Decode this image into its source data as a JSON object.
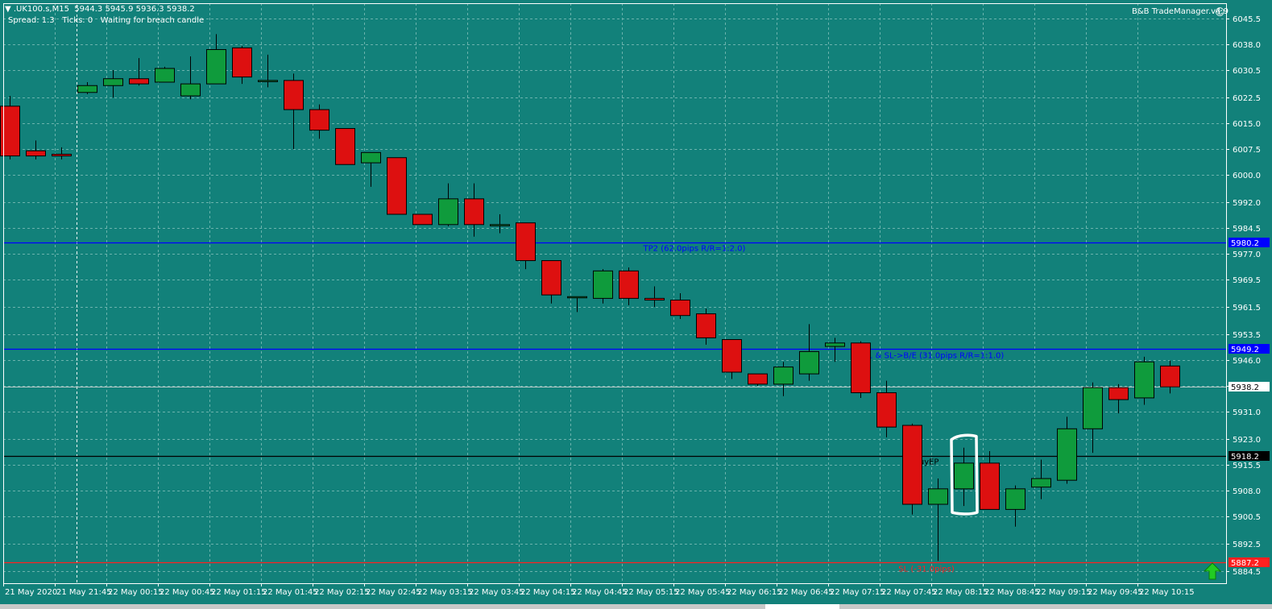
{
  "header": {
    "symbol_line": "▼ .UK100.s,M15  5944.3 5945.9 5936.3 5938.2",
    "status_line": "Spread: 1.3   Ticks: 0   Waiting for breach candle",
    "indicator_name": "B&B TradeManager.v4.9"
  },
  "colors": {
    "background": "#12817a",
    "grid": "#6bb3ad",
    "bull": "#0f9b3c",
    "bear": "#dd1010",
    "tp_line": "#0000ff",
    "entry_line": "#000000",
    "sl_line": "#ff2020",
    "axis_bg": "#ffffff"
  },
  "chart_data": {
    "type": "candlestick",
    "symbol": ".UK100.s",
    "timeframe": "M15",
    "ylim": [
      5881.0,
      6050.0
    ],
    "y_ticks": [
      "6045.5",
      "6038.0",
      "6030.5",
      "6022.5",
      "6015.0",
      "6007.5",
      "6000.0",
      "5992.0",
      "5984.5",
      "5977.0",
      "5969.5",
      "5961.5",
      "5953.5",
      "5946.0",
      "5938.5",
      "5931.0",
      "5923.0",
      "5915.5",
      "5908.0",
      "5900.5",
      "5892.5",
      "5884.5"
    ],
    "x_labels": [
      "21 May 2020",
      "21 May 21:45",
      "22 May 00:15",
      "22 May 00:45",
      "22 May 01:15",
      "22 May 01:45",
      "22 May 02:15",
      "22 May 02:45",
      "22 May 03:15",
      "22 May 03:45",
      "22 May 04:15",
      "22 May 04:45",
      "22 May 05:15",
      "22 May 05:45",
      "22 May 06:15",
      "22 May 06:45",
      "22 May 07:15",
      "22 May 07:45",
      "22 May 08:15",
      "22 May 08:45",
      "22 May 09:15",
      "22 May 09:45",
      "22 May 10:15"
    ],
    "candles": [
      {
        "o": 6020.0,
        "h": 6023.0,
        "l": 6004.5,
        "c": 6005.5
      },
      {
        "o": 6007.0,
        "h": 6010.0,
        "l": 6004.5,
        "c": 6005.5
      },
      {
        "o": 6006.0,
        "h": 6008.0,
        "l": 6004.5,
        "c": 6005.5
      },
      {
        "o": 6024.0,
        "h": 6027.0,
        "l": 6023.5,
        "c": 6026.0
      },
      {
        "o": 6026.0,
        "h": 6030.5,
        "l": 6022.5,
        "c": 6028.0
      },
      {
        "o": 6028.0,
        "h": 6034.0,
        "l": 6026.0,
        "c": 6026.5
      },
      {
        "o": 6027.0,
        "h": 6031.5,
        "l": 6027.0,
        "c": 6031.0
      },
      {
        "o": 6023.0,
        "h": 6034.5,
        "l": 6022.0,
        "c": 6026.5
      },
      {
        "o": 6026.5,
        "h": 6041.0,
        "l": 6026.5,
        "c": 6036.5
      },
      {
        "o": 6037.0,
        "h": 6037.5,
        "l": 6026.5,
        "c": 6028.5
      },
      {
        "o": 6027.5,
        "h": 6035.0,
        "l": 6025.5,
        "c": 6027.5
      },
      {
        "o": 6027.5,
        "h": 6029.5,
        "l": 6007.5,
        "c": 6019.0
      },
      {
        "o": 6019.0,
        "h": 6020.5,
        "l": 6010.5,
        "c": 6013.0
      },
      {
        "o": 6013.5,
        "h": 6013.5,
        "l": 6003.0,
        "c": 6003.0
      },
      {
        "o": 6003.5,
        "h": 6006.5,
        "l": 5996.5,
        "c": 6006.5
      },
      {
        "o": 6005.0,
        "h": 6005.0,
        "l": 5988.5,
        "c": 5988.5
      },
      {
        "o": 5988.5,
        "h": 5988.5,
        "l": 5985.5,
        "c": 5985.5
      },
      {
        "o": 5985.5,
        "h": 5997.5,
        "l": 5985.0,
        "c": 5993.0
      },
      {
        "o": 5993.0,
        "h": 5997.5,
        "l": 5982.0,
        "c": 5985.5
      },
      {
        "o": 5985.5,
        "h": 5988.5,
        "l": 5983.0,
        "c": 5985.5
      },
      {
        "o": 5986.0,
        "h": 5986.0,
        "l": 5972.5,
        "c": 5975.0
      },
      {
        "o": 5975.0,
        "h": 5975.0,
        "l": 5962.5,
        "c": 5965.0
      },
      {
        "o": 5964.5,
        "h": 5964.5,
        "l": 5960.0,
        "c": 5964.5
      },
      {
        "o": 5964.0,
        "h": 5972.5,
        "l": 5962.5,
        "c": 5972.0
      },
      {
        "o": 5972.0,
        "h": 5973.0,
        "l": 5962.0,
        "c": 5964.0
      },
      {
        "o": 5964.0,
        "h": 5967.5,
        "l": 5961.5,
        "c": 5963.5
      },
      {
        "o": 5963.5,
        "h": 5965.5,
        "l": 5958.0,
        "c": 5959.0
      },
      {
        "o": 5959.5,
        "h": 5961.0,
        "l": 5950.5,
        "c": 5952.5
      },
      {
        "o": 5952.0,
        "h": 5952.0,
        "l": 5940.5,
        "c": 5942.5
      },
      {
        "o": 5942.0,
        "h": 5942.0,
        "l": 5938.5,
        "c": 5939.0
      },
      {
        "o": 5939.0,
        "h": 5945.5,
        "l": 5935.5,
        "c": 5944.0
      },
      {
        "o": 5942.0,
        "h": 5956.5,
        "l": 5940.0,
        "c": 5948.5
      },
      {
        "o": 5950.0,
        "h": 5952.5,
        "l": 5945.5,
        "c": 5951.0
      },
      {
        "o": 5951.0,
        "h": 5951.5,
        "l": 5935.0,
        "c": 5936.5
      },
      {
        "o": 5936.5,
        "h": 5940.0,
        "l": 5923.5,
        "c": 5926.5
      },
      {
        "o": 5927.0,
        "h": 5927.5,
        "l": 5901.0,
        "c": 5904.0
      },
      {
        "o": 5904.0,
        "h": 5911.5,
        "l": 5887.5,
        "c": 5908.5
      },
      {
        "o": 5908.5,
        "h": 5920.5,
        "l": 5903.5,
        "c": 5916.0
      },
      {
        "o": 5916.0,
        "h": 5919.5,
        "l": 5902.5,
        "c": 5902.5
      },
      {
        "o": 5902.5,
        "h": 5909.5,
        "l": 5897.5,
        "c": 5908.5
      },
      {
        "o": 5909.0,
        "h": 5917.0,
        "l": 5905.5,
        "c": 5911.5
      },
      {
        "o": 5911.0,
        "h": 5929.5,
        "l": 5910.0,
        "c": 5926.0
      },
      {
        "o": 5926.0,
        "h": 5939.5,
        "l": 5919.0,
        "c": 5938.0
      },
      {
        "o": 5938.0,
        "h": 5939.0,
        "l": 5930.5,
        "c": 5934.5
      },
      {
        "o": 5935.0,
        "h": 5947.0,
        "l": 5933.0,
        "c": 5945.5
      },
      {
        "o": 5944.3,
        "h": 5945.9,
        "l": 5936.3,
        "c": 5938.2
      }
    ],
    "levels": [
      {
        "name": "TP2",
        "price": 5980.2,
        "axis_label": "5980.2",
        "text": "TP2 (62.0pips R/R=1:2.0)",
        "color": "#0000ff"
      },
      {
        "name": "TP1",
        "price": 5949.2,
        "axis_label": "5949.2",
        "text": "TP1 & SL->B/E (31.0pips R/R=1:1.0)",
        "color": "#0000ff"
      },
      {
        "name": "BuyEP",
        "price": 5918.2,
        "axis_label": "5918.2",
        "text": "BuyEP",
        "color": "#000000"
      },
      {
        "name": "SL",
        "price": 5887.2,
        "axis_label": "5887.2",
        "text": "SL (-31.0pips)",
        "color": "#ff2020"
      }
    ],
    "current_price": {
      "price": 5938.2,
      "axis_label": "5938.2"
    },
    "period_separator_index": 3,
    "highlighted_candle_index": 37,
    "grid": true
  }
}
